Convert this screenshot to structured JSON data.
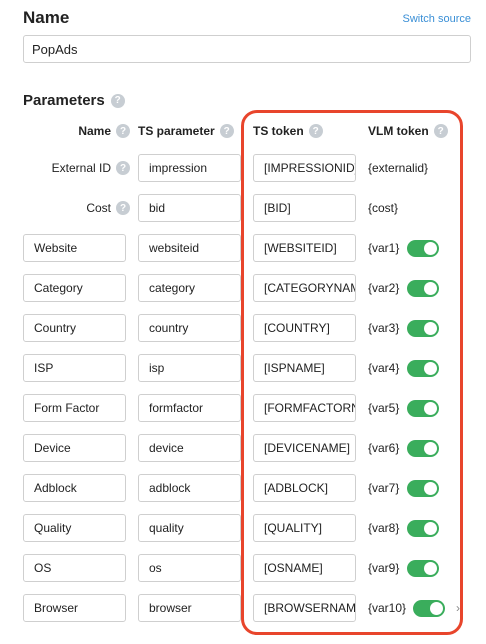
{
  "header": {
    "title": "Name",
    "switch_source": "Switch source"
  },
  "name_field": {
    "value": "PopAds"
  },
  "parameters": {
    "title": "Parameters",
    "columns": {
      "name": "Name",
      "ts_parameter": "TS parameter",
      "ts_token": "TS token",
      "vlm_token": "VLM token"
    },
    "help_glyph": "?",
    "rows": [
      {
        "name": "External ID",
        "ts_parameter": "impression",
        "ts_token": "[IMPRESSIONID]",
        "vlm_token": "{externalid}",
        "static": true,
        "toggle": false
      },
      {
        "name": "Cost",
        "ts_parameter": "bid",
        "ts_token": "[BID]",
        "vlm_token": "{cost}",
        "static": true,
        "toggle": false
      },
      {
        "name": "Website",
        "ts_parameter": "websiteid",
        "ts_token": "[WEBSITEID]",
        "vlm_token": "{var1}",
        "static": false,
        "toggle": true
      },
      {
        "name": "Category",
        "ts_parameter": "category",
        "ts_token": "[CATEGORYNAME]",
        "vlm_token": "{var2}",
        "static": false,
        "toggle": true
      },
      {
        "name": "Country",
        "ts_parameter": "country",
        "ts_token": "[COUNTRY]",
        "vlm_token": "{var3}",
        "static": false,
        "toggle": true
      },
      {
        "name": "ISP",
        "ts_parameter": "isp",
        "ts_token": "[ISPNAME]",
        "vlm_token": "{var4}",
        "static": false,
        "toggle": true
      },
      {
        "name": "Form Factor",
        "ts_parameter": "formfactor",
        "ts_token": "[FORMFACTORNAME]",
        "vlm_token": "{var5}",
        "static": false,
        "toggle": true
      },
      {
        "name": "Device",
        "ts_parameter": "device",
        "ts_token": "[DEVICENAME]",
        "vlm_token": "{var6}",
        "static": false,
        "toggle": true
      },
      {
        "name": "Adblock",
        "ts_parameter": "adblock",
        "ts_token": "[ADBLOCK]",
        "vlm_token": "{var7}",
        "static": false,
        "toggle": true
      },
      {
        "name": "Quality",
        "ts_parameter": "quality",
        "ts_token": "[QUALITY]",
        "vlm_token": "{var8}",
        "static": false,
        "toggle": true
      },
      {
        "name": "OS",
        "ts_parameter": "os",
        "ts_token": "[OSNAME]",
        "vlm_token": "{var9}",
        "static": false,
        "toggle": true
      },
      {
        "name": "Browser",
        "ts_parameter": "browser",
        "ts_token": "[BROWSERNAME]",
        "vlm_token": "{var10}",
        "static": false,
        "toggle": true
      }
    ]
  },
  "colors": {
    "toggle_on": "#3aad5c",
    "highlight": "#e8452c",
    "link": "#3a8fd6"
  },
  "icons": {
    "help": "help-icon",
    "chevron": "chevron-right-icon"
  },
  "chevron_glyph": "›"
}
